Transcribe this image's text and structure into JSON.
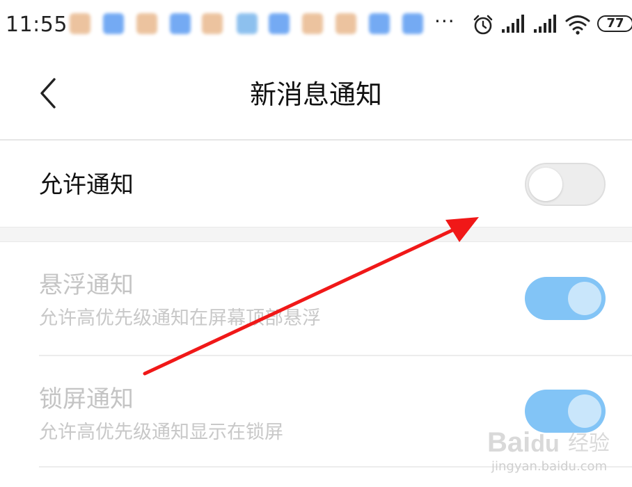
{
  "status_bar": {
    "time": "11:55",
    "dots": "···",
    "battery": "77",
    "icons": [
      "alarm-icon",
      "signal-icon",
      "signal-icon",
      "wifi-icon",
      "battery-icon"
    ],
    "notification_icon_colors": [
      "#e9b98f",
      "#5c9cf2",
      "#e9b98f",
      "#5c9cf2",
      "#e9b98f",
      "#7ab6ec",
      "#5c9cf2",
      "#e9b98f",
      "#e9b98f",
      "#5c9cf2",
      "#5c9cf2"
    ]
  },
  "header": {
    "back_icon": "chevron-left-icon",
    "title": "新消息通知"
  },
  "allow_notification": {
    "label": "允许通知",
    "enabled": false
  },
  "settings": [
    {
      "title": "悬浮通知",
      "description": "允许高优先级通知在屏幕顶部悬浮",
      "enabled": true
    },
    {
      "title": "锁屏通知",
      "description": "允许高优先级通知显示在锁屏",
      "enabled": true
    }
  ],
  "annotation": {
    "arrow_color": "#f01818"
  },
  "watermark": {
    "brand": "Bai",
    "brand_suffix": "du",
    "jingyan": "经验",
    "url": "jingyan.baidu.com"
  },
  "colors": {
    "toggle_on": "#82c4f6",
    "toggle_off": "#ededed",
    "disabled_text": "#c4c4c4"
  }
}
